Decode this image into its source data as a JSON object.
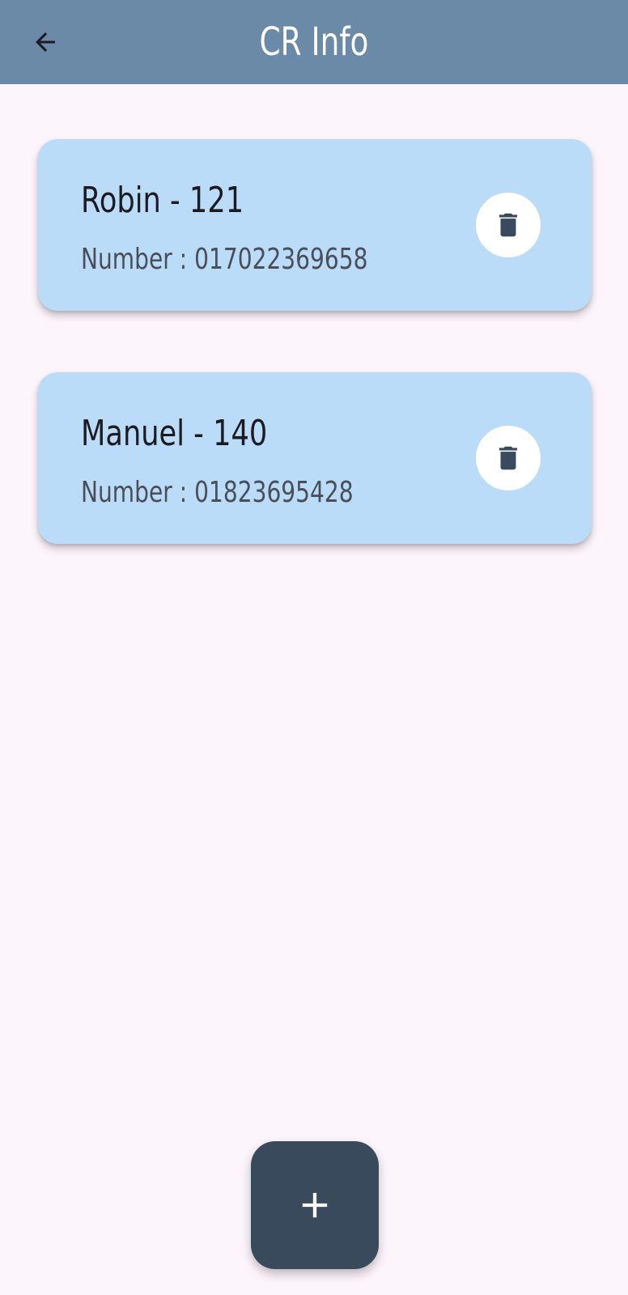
{
  "appbar": {
    "title": "CR Info",
    "back_icon": "arrow-left-icon",
    "background_color": "#6a8aa8"
  },
  "entries": [
    {
      "name": "Robin - 121",
      "number": "Number : 017022369658",
      "delete_icon": "trash-icon"
    },
    {
      "name": "Manuel - 140",
      "number": "Number : 01823695428",
      "delete_icon": "trash-icon"
    }
  ],
  "fab": {
    "icon": "plus-icon",
    "color": "#384a5c"
  },
  "colors": {
    "card": "#bbdcf8",
    "background": "#fdf5fc"
  }
}
